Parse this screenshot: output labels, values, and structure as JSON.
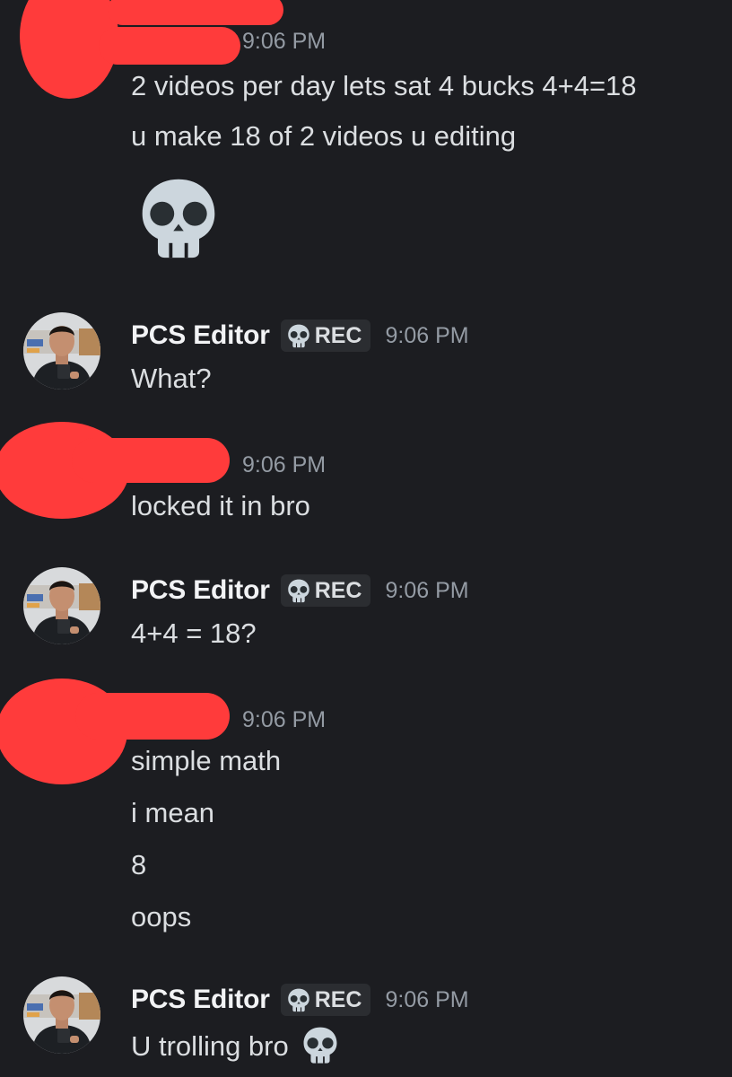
{
  "groups": [
    {
      "time": "9:06 PM",
      "messages": [
        "2 videos per day lets sat 4 bucks 4+4=18",
        "u make 18 of 2 videos u editing"
      ],
      "emoji": "skull-emoji"
    },
    {
      "username": "PCS Editor",
      "tag": "REC",
      "time": "9:06 PM",
      "messages": [
        "What?"
      ]
    },
    {
      "time": "9:06 PM",
      "messages": [
        "locked it in bro"
      ]
    },
    {
      "username": "PCS Editor",
      "tag": "REC",
      "time": "9:06 PM",
      "messages": [
        "4+4 = 18?"
      ]
    },
    {
      "time": "9:06 PM",
      "messages": [
        "simple math",
        "i mean",
        "8",
        "oops"
      ]
    },
    {
      "username": "PCS Editor",
      "tag": "REC",
      "time": "9:06 PM",
      "messages": [
        "U trolling bro"
      ],
      "trailing_emoji": "skull-emoji"
    }
  ],
  "colors": {
    "background": "#1c1d21",
    "redaction": "#ff3b3b",
    "timestamp": "#949ba4",
    "text": "#dbdee1"
  }
}
